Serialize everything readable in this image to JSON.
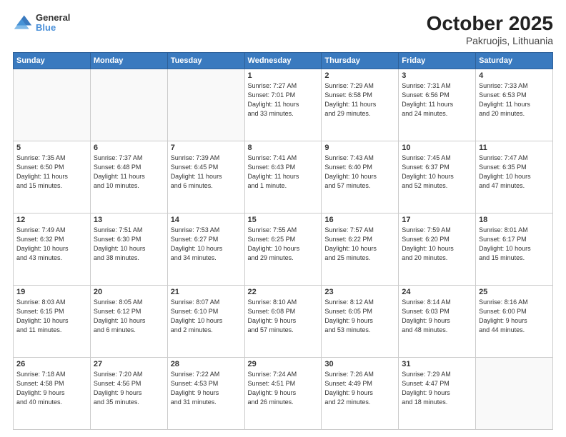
{
  "header": {
    "logo_line1": "General",
    "logo_line2": "Blue",
    "title": "October 2025",
    "subtitle": "Pakruojis, Lithuania"
  },
  "weekdays": [
    "Sunday",
    "Monday",
    "Tuesday",
    "Wednesday",
    "Thursday",
    "Friday",
    "Saturday"
  ],
  "weeks": [
    [
      {
        "day": "",
        "info": ""
      },
      {
        "day": "",
        "info": ""
      },
      {
        "day": "",
        "info": ""
      },
      {
        "day": "1",
        "info": "Sunrise: 7:27 AM\nSunset: 7:01 PM\nDaylight: 11 hours\nand 33 minutes."
      },
      {
        "day": "2",
        "info": "Sunrise: 7:29 AM\nSunset: 6:58 PM\nDaylight: 11 hours\nand 29 minutes."
      },
      {
        "day": "3",
        "info": "Sunrise: 7:31 AM\nSunset: 6:56 PM\nDaylight: 11 hours\nand 24 minutes."
      },
      {
        "day": "4",
        "info": "Sunrise: 7:33 AM\nSunset: 6:53 PM\nDaylight: 11 hours\nand 20 minutes."
      }
    ],
    [
      {
        "day": "5",
        "info": "Sunrise: 7:35 AM\nSunset: 6:50 PM\nDaylight: 11 hours\nand 15 minutes."
      },
      {
        "day": "6",
        "info": "Sunrise: 7:37 AM\nSunset: 6:48 PM\nDaylight: 11 hours\nand 10 minutes."
      },
      {
        "day": "7",
        "info": "Sunrise: 7:39 AM\nSunset: 6:45 PM\nDaylight: 11 hours\nand 6 minutes."
      },
      {
        "day": "8",
        "info": "Sunrise: 7:41 AM\nSunset: 6:43 PM\nDaylight: 11 hours\nand 1 minute."
      },
      {
        "day": "9",
        "info": "Sunrise: 7:43 AM\nSunset: 6:40 PM\nDaylight: 10 hours\nand 57 minutes."
      },
      {
        "day": "10",
        "info": "Sunrise: 7:45 AM\nSunset: 6:37 PM\nDaylight: 10 hours\nand 52 minutes."
      },
      {
        "day": "11",
        "info": "Sunrise: 7:47 AM\nSunset: 6:35 PM\nDaylight: 10 hours\nand 47 minutes."
      }
    ],
    [
      {
        "day": "12",
        "info": "Sunrise: 7:49 AM\nSunset: 6:32 PM\nDaylight: 10 hours\nand 43 minutes."
      },
      {
        "day": "13",
        "info": "Sunrise: 7:51 AM\nSunset: 6:30 PM\nDaylight: 10 hours\nand 38 minutes."
      },
      {
        "day": "14",
        "info": "Sunrise: 7:53 AM\nSunset: 6:27 PM\nDaylight: 10 hours\nand 34 minutes."
      },
      {
        "day": "15",
        "info": "Sunrise: 7:55 AM\nSunset: 6:25 PM\nDaylight: 10 hours\nand 29 minutes."
      },
      {
        "day": "16",
        "info": "Sunrise: 7:57 AM\nSunset: 6:22 PM\nDaylight: 10 hours\nand 25 minutes."
      },
      {
        "day": "17",
        "info": "Sunrise: 7:59 AM\nSunset: 6:20 PM\nDaylight: 10 hours\nand 20 minutes."
      },
      {
        "day": "18",
        "info": "Sunrise: 8:01 AM\nSunset: 6:17 PM\nDaylight: 10 hours\nand 15 minutes."
      }
    ],
    [
      {
        "day": "19",
        "info": "Sunrise: 8:03 AM\nSunset: 6:15 PM\nDaylight: 10 hours\nand 11 minutes."
      },
      {
        "day": "20",
        "info": "Sunrise: 8:05 AM\nSunset: 6:12 PM\nDaylight: 10 hours\nand 6 minutes."
      },
      {
        "day": "21",
        "info": "Sunrise: 8:07 AM\nSunset: 6:10 PM\nDaylight: 10 hours\nand 2 minutes."
      },
      {
        "day": "22",
        "info": "Sunrise: 8:10 AM\nSunset: 6:08 PM\nDaylight: 9 hours\nand 57 minutes."
      },
      {
        "day": "23",
        "info": "Sunrise: 8:12 AM\nSunset: 6:05 PM\nDaylight: 9 hours\nand 53 minutes."
      },
      {
        "day": "24",
        "info": "Sunrise: 8:14 AM\nSunset: 6:03 PM\nDaylight: 9 hours\nand 48 minutes."
      },
      {
        "day": "25",
        "info": "Sunrise: 8:16 AM\nSunset: 6:00 PM\nDaylight: 9 hours\nand 44 minutes."
      }
    ],
    [
      {
        "day": "26",
        "info": "Sunrise: 7:18 AM\nSunset: 4:58 PM\nDaylight: 9 hours\nand 40 minutes."
      },
      {
        "day": "27",
        "info": "Sunrise: 7:20 AM\nSunset: 4:56 PM\nDaylight: 9 hours\nand 35 minutes."
      },
      {
        "day": "28",
        "info": "Sunrise: 7:22 AM\nSunset: 4:53 PM\nDaylight: 9 hours\nand 31 minutes."
      },
      {
        "day": "29",
        "info": "Sunrise: 7:24 AM\nSunset: 4:51 PM\nDaylight: 9 hours\nand 26 minutes."
      },
      {
        "day": "30",
        "info": "Sunrise: 7:26 AM\nSunset: 4:49 PM\nDaylight: 9 hours\nand 22 minutes."
      },
      {
        "day": "31",
        "info": "Sunrise: 7:29 AM\nSunset: 4:47 PM\nDaylight: 9 hours\nand 18 minutes."
      },
      {
        "day": "",
        "info": ""
      }
    ]
  ]
}
